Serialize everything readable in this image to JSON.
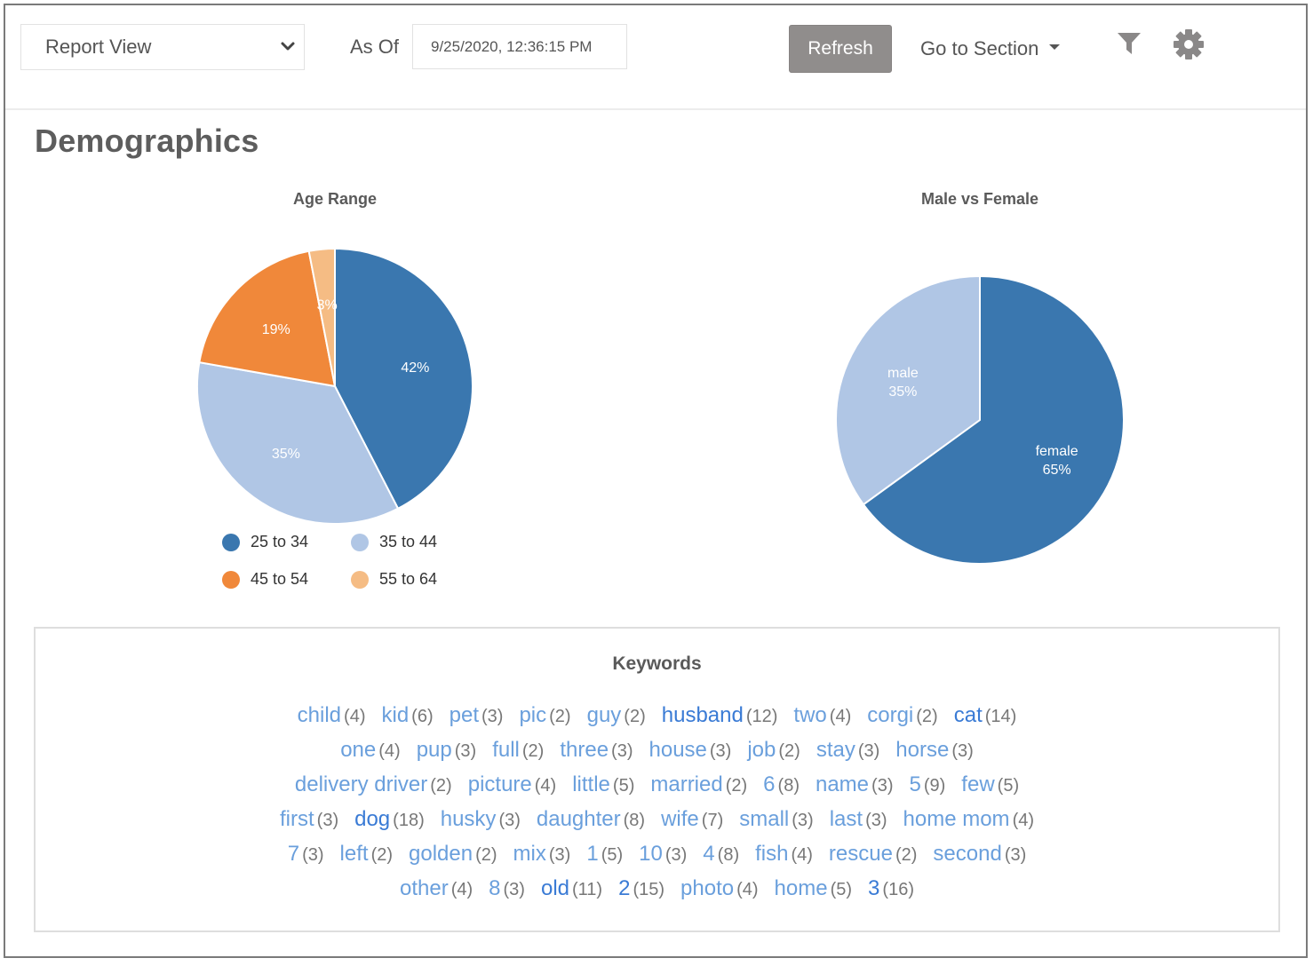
{
  "toolbar": {
    "view_select": {
      "value": "Report View"
    },
    "as_of_label": "As Of",
    "as_of_value": "9/25/2020, 12:36:15 PM",
    "refresh_label": "Refresh",
    "goto_label": "Go to Section",
    "icons": [
      "filter-icon",
      "gear-icon"
    ]
  },
  "section": {
    "title": "Demographics"
  },
  "colors": {
    "blue_dark": "#3a77af",
    "blue_light": "#b0c6e5",
    "orange": "#f0883a",
    "orange_light": "#f5bc84",
    "keyword": "#6a9fdc",
    "keyword_strong": "#3a7bd5"
  },
  "chart_data": [
    {
      "type": "pie",
      "title": "Age Range",
      "categories": [
        "25 to 34",
        "35 to 44",
        "45 to 54",
        "55 to 64"
      ],
      "values": [
        42,
        35,
        19,
        3
      ],
      "labels": [
        "42%",
        "35%",
        "19%",
        "3%"
      ],
      "colors": [
        "#3a77af",
        "#b0c6e5",
        "#f0883a",
        "#f5bc84"
      ],
      "legend": "bottom"
    },
    {
      "type": "pie",
      "title": "Male vs Female",
      "categories": [
        "female",
        "male"
      ],
      "values": [
        65,
        35
      ],
      "labels": [
        "65%",
        "35%"
      ],
      "colors": [
        "#3a77af",
        "#b0c6e5"
      ],
      "legend": "none"
    }
  ],
  "keywords": {
    "title": "Keywords",
    "lines": [
      [
        [
          "child",
          4
        ],
        [
          "kid",
          6
        ],
        [
          "pet",
          3
        ],
        [
          "pic",
          2
        ],
        [
          "guy",
          2
        ],
        [
          "husband",
          12
        ],
        [
          "two",
          4
        ],
        [
          "corgi",
          2
        ],
        [
          "cat",
          14
        ]
      ],
      [
        [
          "one",
          4
        ],
        [
          "pup",
          3
        ],
        [
          "full",
          2
        ],
        [
          "three",
          3
        ],
        [
          "house",
          3
        ],
        [
          "job",
          2
        ],
        [
          "stay",
          3
        ],
        [
          "horse",
          3
        ]
      ],
      [
        [
          "delivery driver",
          2
        ],
        [
          "picture",
          4
        ],
        [
          "little",
          5
        ],
        [
          "married",
          2
        ],
        [
          "6",
          8
        ],
        [
          "name",
          3
        ],
        [
          "5",
          9
        ],
        [
          "few",
          5
        ]
      ],
      [
        [
          "first",
          3
        ],
        [
          "dog",
          18
        ],
        [
          "husky",
          3
        ],
        [
          "daughter",
          8
        ],
        [
          "wife",
          7
        ],
        [
          "small",
          3
        ],
        [
          "last",
          3
        ],
        [
          "home mom",
          4
        ]
      ],
      [
        [
          "7",
          3
        ],
        [
          "left",
          2
        ],
        [
          "golden",
          2
        ],
        [
          "mix",
          3
        ],
        [
          "1",
          5
        ],
        [
          "10",
          3
        ],
        [
          "4",
          8
        ],
        [
          "fish",
          4
        ],
        [
          "rescue",
          2
        ],
        [
          "second",
          3
        ]
      ],
      [
        [
          "other",
          4
        ],
        [
          "8",
          3
        ],
        [
          "old",
          11
        ],
        [
          "2",
          15
        ],
        [
          "photo",
          4
        ],
        [
          "home",
          5
        ],
        [
          "3",
          16
        ]
      ]
    ]
  }
}
